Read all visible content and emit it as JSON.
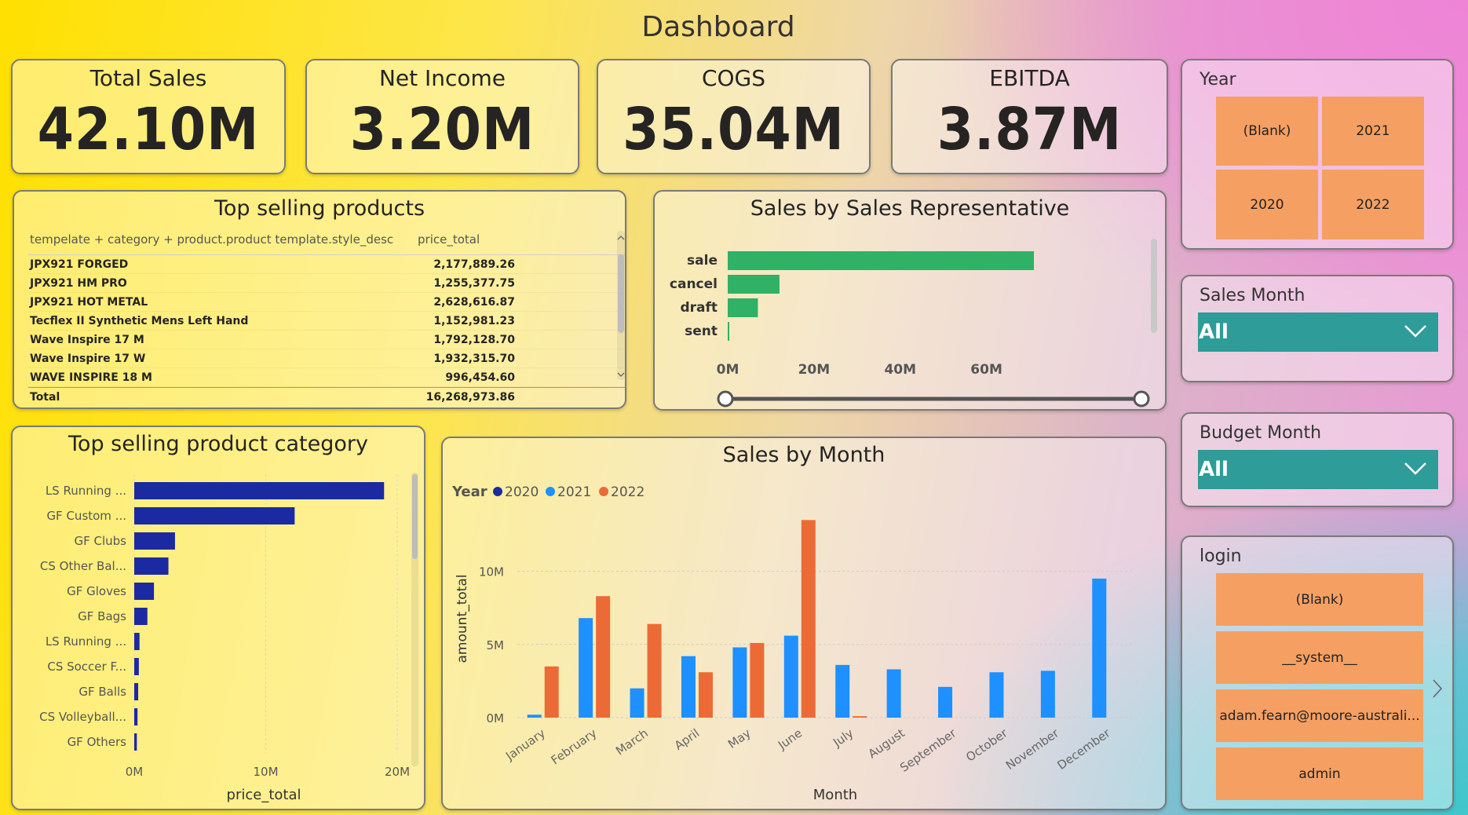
{
  "page": {
    "title": "Dashboard"
  },
  "kpis": [
    {
      "title": "Total Sales",
      "value": "42.10M"
    },
    {
      "title": "Net Income",
      "value": "3.20M"
    },
    {
      "title": "COGS",
      "value": "35.04M"
    },
    {
      "title": "EBITDA",
      "value": "3.87M"
    }
  ],
  "top_products": {
    "title": "Top selling products",
    "columns": [
      "tempelate + category + product.product template.style_desc",
      "price_total"
    ],
    "rows": [
      {
        "name": "JPX921 FORGED",
        "value": "2,177,889.26"
      },
      {
        "name": "JPX921 HM PRO",
        "value": "1,255,377.75"
      },
      {
        "name": "JPX921 HOT METAL",
        "value": "2,628,616.87"
      },
      {
        "name": "Tecflex II Synthetic Mens Left Hand",
        "value": "1,152,981.23"
      },
      {
        "name": "Wave Inspire 17 M",
        "value": "1,792,128.70"
      },
      {
        "name": "Wave Inspire 17 W",
        "value": "1,932,315.70"
      },
      {
        "name": "WAVE INSPIRE 18 M",
        "value": "996,454.60"
      }
    ],
    "total_label": "Total",
    "total_value": "16,268,973.86"
  },
  "sales_rep": {
    "title": "Sales by Sales Representative",
    "axis_ticks": [
      "0M",
      "20M",
      "40M",
      "60M"
    ]
  },
  "category": {
    "title": "Top selling product category",
    "xlabel": "price_total",
    "axis_ticks": [
      "0M",
      "10M",
      "20M"
    ]
  },
  "sales_month": {
    "title": "Sales by Month",
    "legend_title": "Year",
    "ylabel": "amount_total",
    "xlabel": "Month",
    "y_ticks": [
      "0M",
      "5M",
      "10M"
    ]
  },
  "slicers": {
    "year": {
      "label": "Year",
      "options": [
        "(Blank)",
        "2021",
        "2020",
        "2022"
      ]
    },
    "sales_month": {
      "label": "Sales Month",
      "value": "All"
    },
    "budget_month": {
      "label": "Budget Month",
      "value": "All"
    },
    "login": {
      "label": "login",
      "options": [
        "(Blank)",
        "__system__",
        "adam.fearn@moore-australi...",
        "admin"
      ]
    }
  },
  "colors": {
    "green_bar": "#2fb166",
    "navy_bar": "#1b2aa1",
    "series_2020": "#1a2c9c",
    "series_2021": "#1e90ff",
    "series_2022": "#ec6a36",
    "tile": "#f5a062",
    "dropdown": "#2e9c98"
  },
  "chart_data": [
    {
      "type": "bar",
      "orientation": "horizontal",
      "title": "Sales by Sales Representative",
      "categories": [
        "sale",
        "cancel",
        "draft",
        "sent"
      ],
      "values": [
        71000000,
        12000000,
        7000000,
        0.5
      ],
      "xlim": [
        0,
        75000000
      ]
    },
    {
      "type": "bar",
      "orientation": "horizontal",
      "title": "Top selling product category",
      "xlabel": "price_total",
      "categories": [
        "LS Running ...",
        "GF Custom ...",
        "GF Clubs",
        "CS Other Bal...",
        "GF Gloves",
        "GF Bags",
        "LS Running ...",
        "CS Soccer F...",
        "GF Balls",
        "CS Volleyball...",
        "GF Others"
      ],
      "values": [
        19000000,
        12200000,
        3100000,
        2600000,
        1500000,
        1000000,
        400000,
        350000,
        300000,
        250000,
        200000
      ],
      "xlim": [
        0,
        20000000
      ]
    },
    {
      "type": "bar",
      "title": "Sales by Month",
      "xlabel": "Month",
      "ylabel": "amount_total",
      "legend_title": "Year",
      "categories": [
        "January",
        "February",
        "March",
        "April",
        "May",
        "June",
        "July",
        "August",
        "September",
        "October",
        "November",
        "December"
      ],
      "series": [
        {
          "name": "2020",
          "values": [
            0,
            0,
            0,
            0,
            0,
            0,
            0,
            0,
            0,
            0,
            0,
            0
          ]
        },
        {
          "name": "2021",
          "values": [
            0.2,
            6.8,
            2.0,
            4.2,
            4.8,
            5.6,
            3.6,
            3.3,
            2.1,
            3.1,
            3.2,
            9.5
          ]
        },
        {
          "name": "2022",
          "values": [
            3.5,
            8.3,
            6.4,
            3.1,
            5.1,
            13.5,
            0.1,
            0,
            0,
            0,
            0,
            0
          ]
        }
      ],
      "units": "M",
      "ylim": [
        0,
        14
      ]
    }
  ]
}
